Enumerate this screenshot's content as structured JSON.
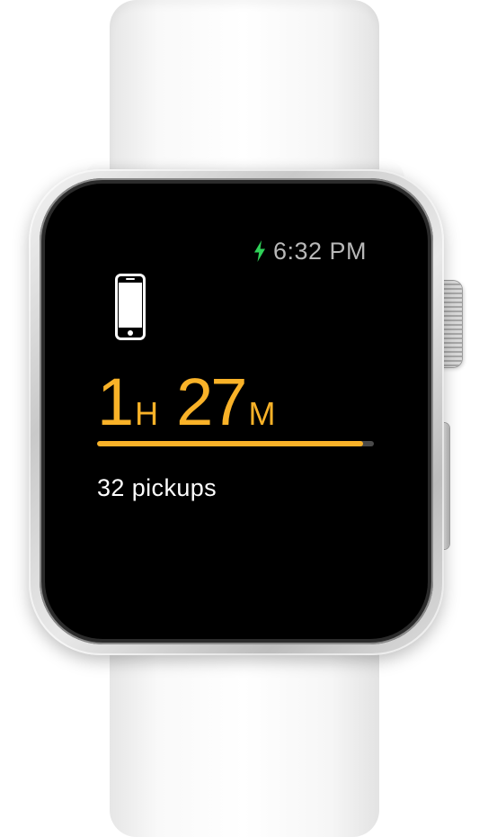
{
  "status_bar": {
    "charging_icon": "lightning-bolt-icon",
    "time": "6:32 PM"
  },
  "device_icon": "iphone-icon",
  "usage": {
    "hours": "1",
    "hours_unit": "H",
    "minutes": "27",
    "minutes_unit": "M",
    "progress_fraction": 0.96
  },
  "pickups": "32 pickups",
  "colors": {
    "accent": "#f9b228",
    "charging": "#2fd158",
    "time_text": "#b8b8b8",
    "background": "#000000"
  }
}
